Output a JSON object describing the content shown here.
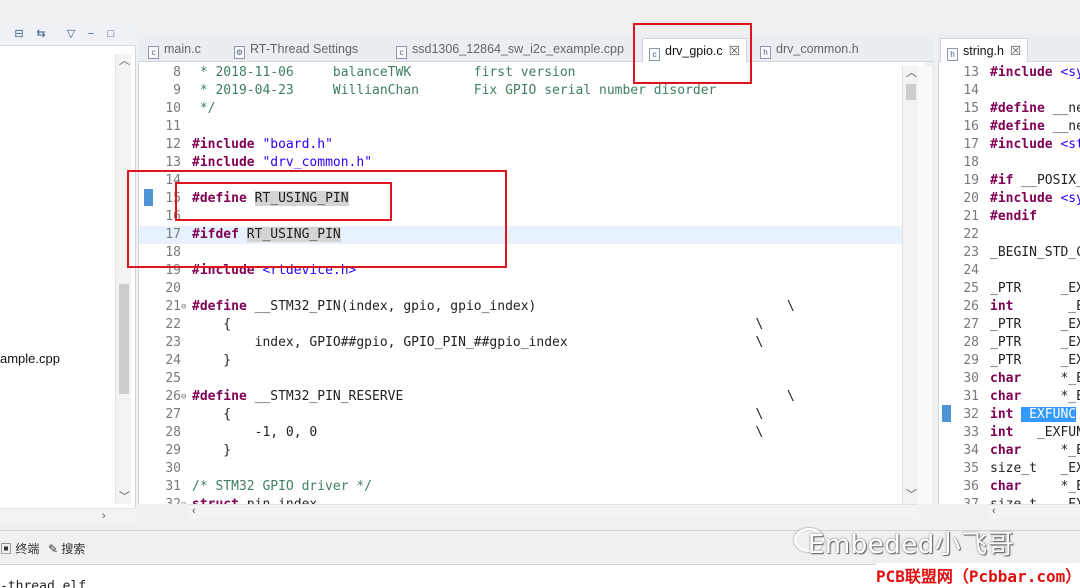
{
  "left_panel": {
    "toolbar_icons": [
      "collapse-icon",
      "link-icon",
      "view-menu-icon",
      "minimize-icon",
      "maximize-icon"
    ],
    "visible_item": "ample.cpp"
  },
  "editor_tabs": [
    {
      "label": "main.c",
      "icon": "c"
    },
    {
      "label": "RT-Thread Settings",
      "icon": "⚙"
    },
    {
      "label": "ssd1306_12864_sw_i2c_example.cpp",
      "icon": "c"
    },
    {
      "label": "drv_gpio.c",
      "icon": "c",
      "close": "☒"
    },
    {
      "label": "drv_common.h",
      "icon": "h"
    }
  ],
  "editor_lines": [
    {
      "n": "8",
      "t": " * 2018-11-06     balanceTWK        first version"
    },
    {
      "n": "9",
      "t": " * 2019-04-23     WillianChan       Fix GPIO serial number disorder"
    },
    {
      "n": "10",
      "t": " */"
    },
    {
      "n": "11",
      "t": ""
    },
    {
      "n": "12",
      "kw": "#include",
      "str": "\"board.h\""
    },
    {
      "n": "13",
      "kw": "#include",
      "str": "\"drv_common.h\""
    },
    {
      "n": "14",
      "t": ""
    },
    {
      "n": "15",
      "kw": "#define",
      "hl": "RT_USING_PIN"
    },
    {
      "n": "16",
      "t": ""
    },
    {
      "n": "17",
      "kw": "#ifdef",
      "hl": "RT_USING_PIN"
    },
    {
      "n": "18",
      "t": ""
    },
    {
      "n": "19",
      "kw": "#include",
      "str": "<rtdevice.h>"
    },
    {
      "n": "20",
      "t": ""
    },
    {
      "n": "21",
      "kw": "#define",
      "t": "__STM32_PIN(index, gpio, gpio_index)                                \\"
    },
    {
      "n": "22",
      "t": "    {                                                                   \\"
    },
    {
      "n": "23",
      "t": "        index, GPIO##gpio, GPIO_PIN_##gpio_index                        \\"
    },
    {
      "n": "24",
      "t": "    }"
    },
    {
      "n": "25",
      "t": ""
    },
    {
      "n": "26",
      "kw": "#define",
      "t": "__STM32_PIN_RESERVE                                                 \\"
    },
    {
      "n": "27",
      "t": "    {                                                                   \\"
    },
    {
      "n": "28",
      "t": "        -1, 0, 0                                                        \\"
    },
    {
      "n": "29",
      "t": "    }"
    },
    {
      "n": "30",
      "t": ""
    },
    {
      "n": "31",
      "cm": "/* STM32 GPIO driver */"
    },
    {
      "n": "32",
      "kw": "struct",
      "t": "pin_index"
    }
  ],
  "right_tab": {
    "label": "string.h",
    "close": "☒"
  },
  "right_lines": [
    {
      "n": "13",
      "kw": "#include",
      "str": "<sy"
    },
    {
      "n": "14",
      "t": ""
    },
    {
      "n": "15",
      "kw": "#define",
      "t": "__ne"
    },
    {
      "n": "16",
      "kw": "#define",
      "t": "__ne"
    },
    {
      "n": "17",
      "kw": "#include",
      "str": "<st"
    },
    {
      "n": "18",
      "t": ""
    },
    {
      "n": "19",
      "kw": "#if",
      "t": "__POSIX_"
    },
    {
      "n": "20",
      "kw": "#include",
      "str": "<sy"
    },
    {
      "n": "21",
      "kw": "#endif",
      "t": ""
    },
    {
      "n": "22",
      "t": ""
    },
    {
      "n": "23",
      "t": "_BEGIN_STD_C"
    },
    {
      "n": "24",
      "t": ""
    },
    {
      "n": "25",
      "t": "_PTR     _EX"
    },
    {
      "n": "26",
      "kw": "int",
      "t": "      _EX"
    },
    {
      "n": "27",
      "t": "_PTR     _EX"
    },
    {
      "n": "28",
      "t": "_PTR     _EX"
    },
    {
      "n": "29",
      "t": "_PTR     _EX"
    },
    {
      "n": "30",
      "kw": "char",
      "t": "    *_EX"
    },
    {
      "n": "31",
      "kw": "char",
      "t": "    *_EX"
    },
    {
      "n": "32",
      "kw": "int",
      "sel": " EXFUNC"
    },
    {
      "n": "33",
      "kw": "int",
      "t": "  _EXFUNC"
    },
    {
      "n": "34",
      "kw": "char",
      "t": "    *_EX"
    },
    {
      "n": "35",
      "t": "size_t   _EX"
    },
    {
      "n": "36",
      "kw": "char",
      "t": "    *_EX"
    },
    {
      "n": "37",
      "t": "size_t   _EX"
    }
  ],
  "bottom_tabs": [
    {
      "icon": "terminal-icon",
      "glyph": "▣",
      "label": "终端"
    },
    {
      "icon": "search-icon",
      "glyph": "✎",
      "label": "搜索"
    }
  ],
  "console_text": "-thread.elf",
  "watermark": "Embeded小飞哥",
  "site_watermark": "PCB联盟网（Pcbbar.com）"
}
